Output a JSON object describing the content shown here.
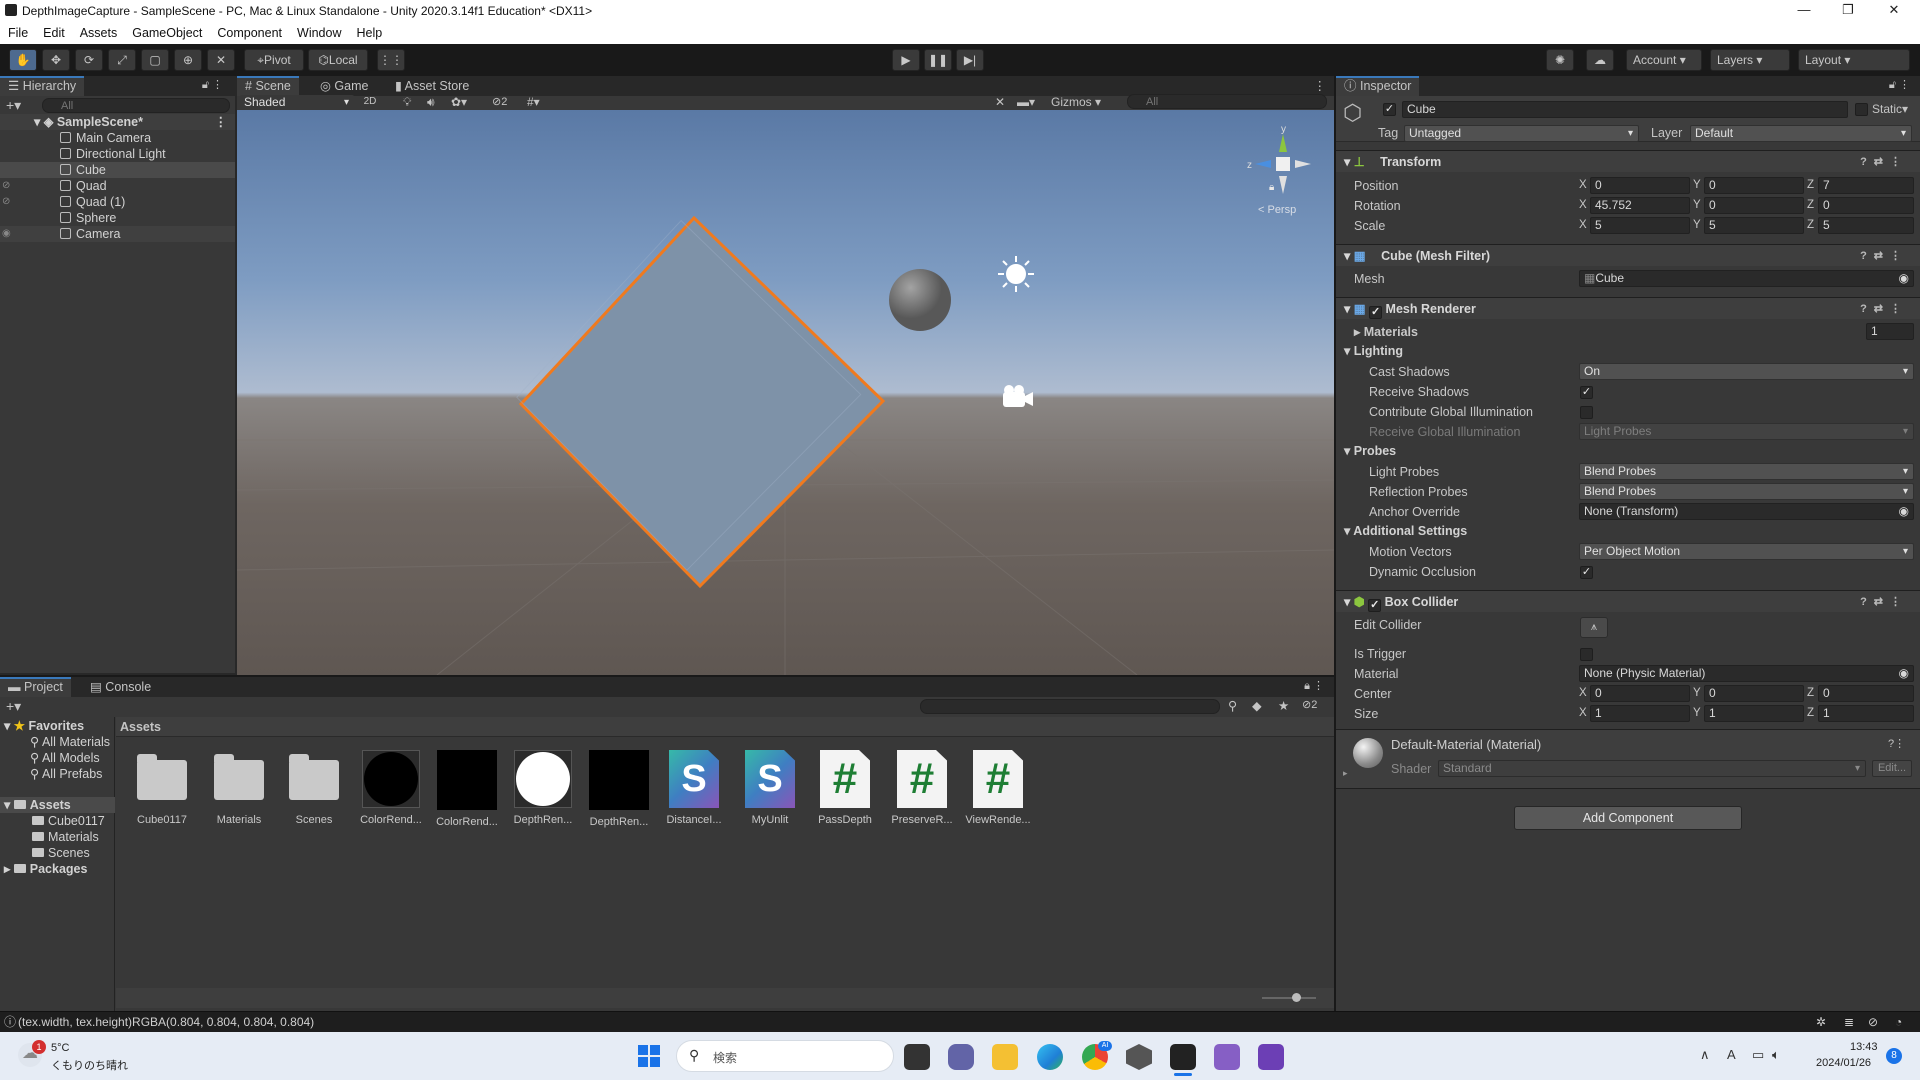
{
  "window": {
    "title": "DepthImageCapture - SampleScene - PC, Mac & Linux Standalone - Unity 2020.3.14f1 Education* <DX11>",
    "minimize": "—",
    "maximize": "❐",
    "close": "✕"
  },
  "menu": [
    "File",
    "Edit",
    "Assets",
    "GameObject",
    "Component",
    "Window",
    "Help"
  ],
  "toolbar": {
    "pivot": "Pivot",
    "local": "Local",
    "account": "Account",
    "layers": "Layers",
    "layout": "Layout"
  },
  "hierarchy": {
    "tab": "Hierarchy",
    "search_placeholder": "All",
    "scene": "SampleScene*",
    "items": [
      "Main Camera",
      "Directional Light",
      "Cube",
      "Quad",
      "Quad (1)",
      "Sphere",
      "Camera"
    ]
  },
  "scene": {
    "tabs": [
      "Scene",
      "Game",
      "Asset Store"
    ],
    "shading": "Shaded",
    "mode2d": "2D",
    "hidden_count": "2",
    "gizmos": "Gizmos",
    "search_placeholder": "All",
    "persp": "< Persp"
  },
  "inspector": {
    "tab": "Inspector",
    "object_name": "Cube",
    "static_label": "Static",
    "tag_label": "Tag",
    "tag": "Untagged",
    "layer_label": "Layer",
    "layer": "Default",
    "transform": {
      "title": "Transform",
      "position_label": "Position",
      "rotation_label": "Rotation",
      "scale_label": "Scale",
      "position": {
        "x": "0",
        "y": "0",
        "z": "7"
      },
      "rotation": {
        "x": "45.752",
        "y": "0",
        "z": "0"
      },
      "scale": {
        "x": "5",
        "y": "5",
        "z": "5"
      }
    },
    "mesh_filter": {
      "title": "Cube (Mesh Filter)",
      "mesh_label": "Mesh",
      "mesh": "Cube"
    },
    "mesh_renderer": {
      "title": "Mesh Renderer",
      "materials_label": "Materials",
      "materials_count": "1",
      "lighting": "Lighting",
      "cast_shadows_label": "Cast Shadows",
      "cast_shadows": "On",
      "receive_shadows_label": "Receive Shadows",
      "contribute_gi_label": "Contribute Global Illumination",
      "receive_gi_label": "Receive Global Illumination",
      "receive_gi": "Light Probes",
      "probes": "Probes",
      "light_probes_label": "Light Probes",
      "light_probes": "Blend Probes",
      "reflection_probes_label": "Reflection Probes",
      "reflection_probes": "Blend Probes",
      "anchor_label": "Anchor Override",
      "anchor": "None (Transform)",
      "additional": "Additional Settings",
      "motion_vectors_label": "Motion Vectors",
      "motion_vectors": "Per Object Motion",
      "dynamic_occlusion_label": "Dynamic Occlusion"
    },
    "box_collider": {
      "title": "Box Collider",
      "edit_label": "Edit Collider",
      "trigger_label": "Is Trigger",
      "material_label": "Material",
      "material": "None (Physic Material)",
      "center_label": "Center",
      "size_label": "Size",
      "center": {
        "x": "0",
        "y": "0",
        "z": "0"
      },
      "size": {
        "x": "1",
        "y": "1",
        "z": "1"
      }
    },
    "material": {
      "title": "Default-Material (Material)",
      "shader_label": "Shader",
      "shader": "Standard",
      "edit": "Edit..."
    },
    "add_component": "Add Component"
  },
  "project": {
    "tabs": [
      "Project",
      "Console"
    ],
    "hidden_count": "2",
    "breadcrumb": "Assets",
    "favorites": "Favorites",
    "fav_items": [
      "All Materials",
      "All Models",
      "All Prefabs"
    ],
    "assets_root": "Assets",
    "asset_folders": [
      "Cube0117",
      "Materials",
      "Scenes"
    ],
    "packages": "Packages",
    "assets": [
      "Cube0117",
      "Materials",
      "Scenes",
      "ColorRend...",
      "ColorRend...",
      "DepthRen...",
      "DepthRen...",
      "DistanceI...",
      "MyUnlit",
      "PassDepth",
      "PreserveR...",
      "ViewRende..."
    ]
  },
  "status": "(tex.width, tex.height)RGBA(0.804, 0.804, 0.804, 0.804)",
  "taskbar": {
    "temp": "5°C",
    "weather": "くもりのち晴れ",
    "weather_badge": "1",
    "search": "検索",
    "time": "13:43",
    "date": "2024/01/26",
    "notif": "8",
    "chrome_badge": "AI"
  },
  "colors": {
    "accent": "#3a79bb",
    "selection_outline": "#f07a1e"
  }
}
